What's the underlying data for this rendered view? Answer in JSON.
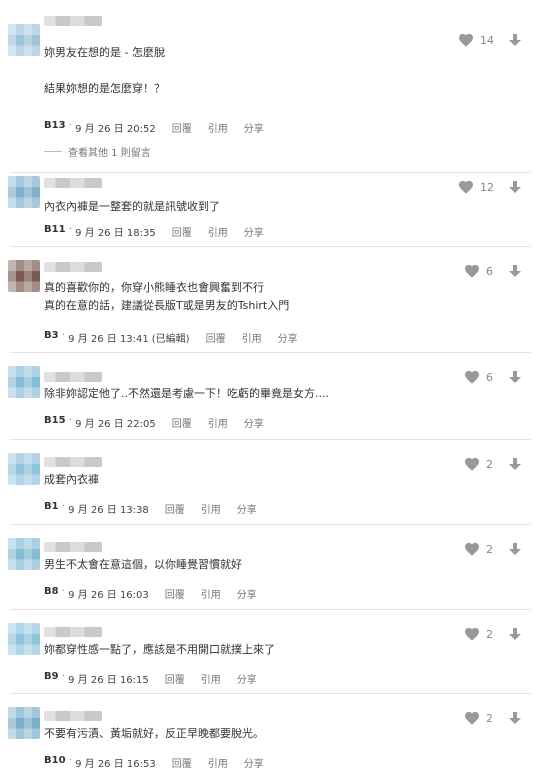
{
  "colors": {
    "text": "#333333",
    "muted": "#888888",
    "icon": "#999999",
    "separator": "#e4e4e4"
  },
  "actions": {
    "reply": "回覆",
    "quote": "引用",
    "share": "分享"
  },
  "comments": [
    {
      "avatar_color": "#9fc4d8",
      "text": "妳男友在想的是 - 怎麼脫\n\n結果妳想的是怎麼穿！？",
      "floor": "B13",
      "time": "9 月 26 日 20:52",
      "edited": "",
      "likes": "14",
      "more_replies": "查看其他 1 則留言"
    },
    {
      "avatar_color": "#7fb0cd",
      "text": "內衣內褲是一整套的就是訊號收到了",
      "floor": "B11",
      "time": "9 月 26 日 18:35",
      "edited": "",
      "likes": "12",
      "more_replies": ""
    },
    {
      "avatar_color": "#7a5a52",
      "text": "真的喜歡你的，你穿小熊睡衣也會興奮到不行\n真的在意的話，建議從長版T或是男友的Tshirt入門",
      "floor": "B3",
      "time": "9 月 26 日 13:41",
      "edited": "(已編輯)",
      "likes": "6",
      "more_replies": ""
    },
    {
      "avatar_color": "#88bdd9",
      "text": "除非妳認定他了..不然還是考慮一下！吃虧的畢竟是女方....",
      "floor": "B15",
      "time": "9 月 26 日 22:05",
      "edited": "",
      "likes": "6",
      "more_replies": ""
    },
    {
      "avatar_color": "#8fc2dc",
      "text": "成套內衣褲",
      "floor": "B1",
      "time": "9 月 26 日 13:38",
      "edited": "",
      "likes": "2",
      "more_replies": ""
    },
    {
      "avatar_color": "#86bdd6",
      "text": "男生不太會在意這個，以你睡覺習慣就好",
      "floor": "B8",
      "time": "9 月 26 日 16:03",
      "edited": "",
      "likes": "2",
      "more_replies": ""
    },
    {
      "avatar_color": "#8ec5dd",
      "text": "妳都穿性感一點了，應該是不用開口就撲上來了",
      "floor": "B9",
      "time": "9 月 26 日 16:15",
      "edited": "",
      "likes": "2",
      "more_replies": ""
    },
    {
      "avatar_color": "#7aaec9",
      "text": "不要有污漬、黃垢就好，反正早晚都要脫光。",
      "floor": "B10",
      "time": "9 月 26 日 16:53",
      "edited": "",
      "likes": "2",
      "more_replies": ""
    }
  ]
}
